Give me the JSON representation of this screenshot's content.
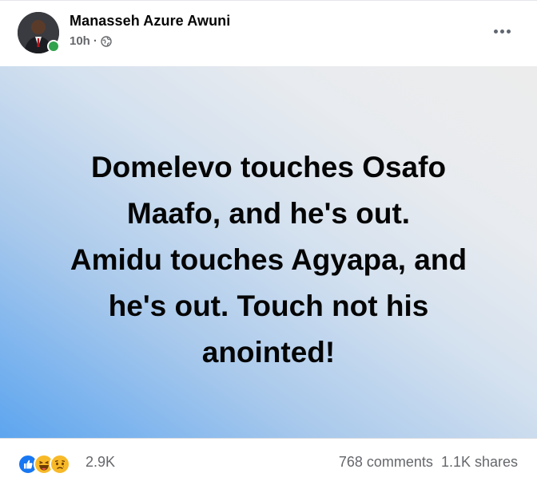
{
  "post": {
    "author": "Manasseh Azure Awuni",
    "time": "10h",
    "separator": "·",
    "privacy_icon": "globe-icon",
    "more_icon": "more-options-icon",
    "text_lines": [
      "Domelevo touches Osafo",
      "Maafo, and he's out.",
      "Amidu touches Agyapa, and",
      "he's out. Touch not his",
      "anointed!"
    ],
    "background": {
      "gradient_from": "#5da5ef",
      "gradient_to": "#ececec"
    }
  },
  "footer": {
    "reaction_icons": [
      "like-icon",
      "haha-icon",
      "sad-icon"
    ],
    "reaction_count": "2.9K",
    "comments": "768 comments",
    "shares": "1.1K shares"
  },
  "colors": {
    "like": "#1877f2",
    "online": "#31a24c",
    "secondary_text": "#65676b"
  }
}
